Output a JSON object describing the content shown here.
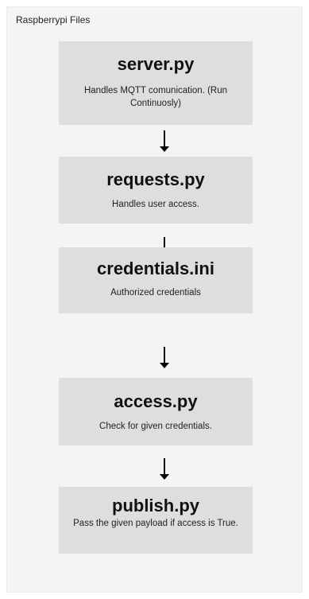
{
  "frame": {
    "title": "Raspberrypi Files"
  },
  "boxes": [
    {
      "title": "server.py",
      "description": "Handles MQTT comunication. (Run Continuosly)"
    },
    {
      "title": "requests.py",
      "description": "Handles user access."
    },
    {
      "title": "credentials.ini",
      "description": "Authorized credentials"
    },
    {
      "title": "access.py",
      "description": "Check for given credentials."
    },
    {
      "title": "publish.py",
      "description": "Pass the given payload if access is True."
    }
  ],
  "colors": {
    "frame_background": "#f4f4f4",
    "box_background": "#dedede",
    "arrow": "#000000"
  },
  "icons": {
    "connector": "arrow-down-icon"
  }
}
